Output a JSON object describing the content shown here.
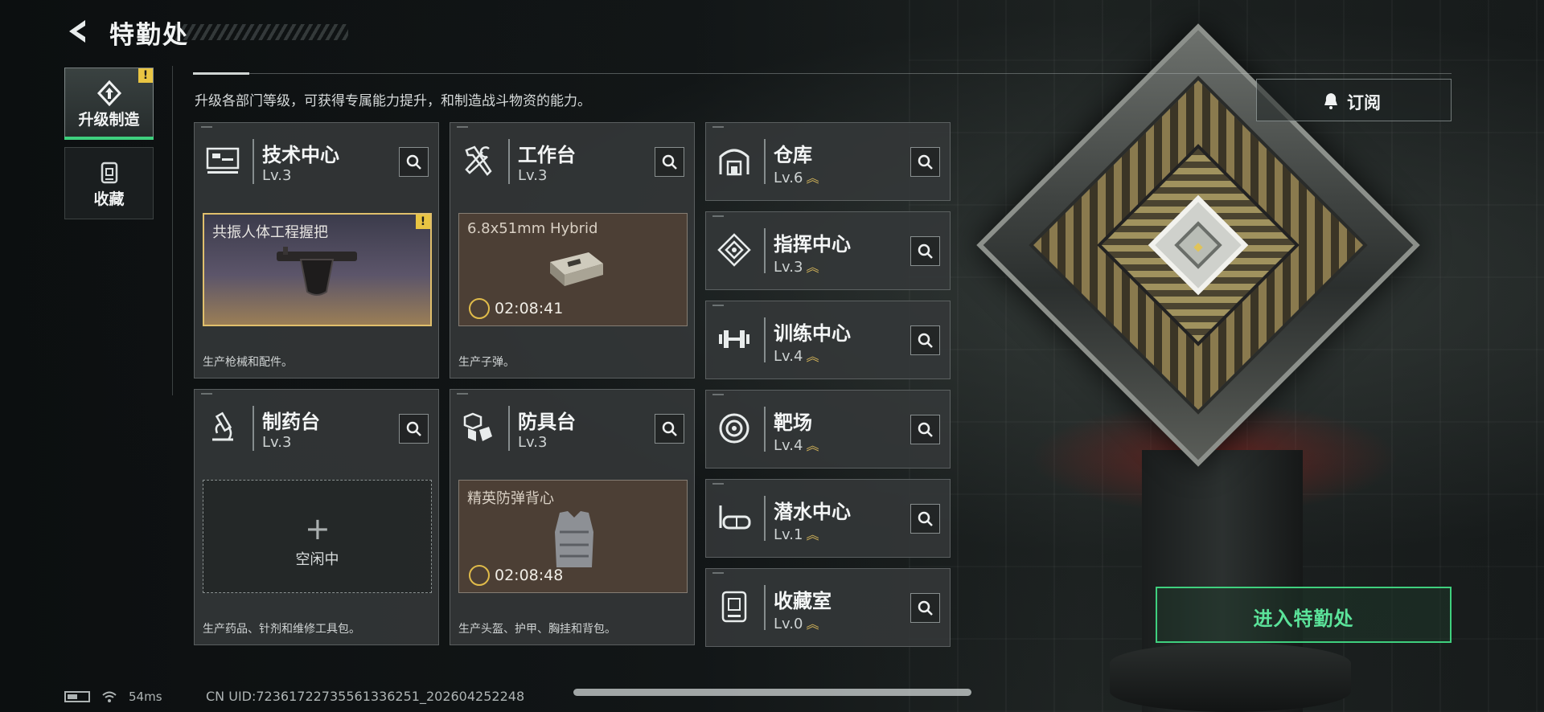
{
  "header": {
    "title": "特勤处"
  },
  "subtitle": "升级各部门等级，可获得专属能力提升，和制造战斗物资的能力。",
  "nav": [
    {
      "label": "升级制造",
      "alert": "!"
    },
    {
      "label": "收藏"
    }
  ],
  "subscribe_label": "订阅",
  "enter_label": "进入特勤处",
  "departments": {
    "tech": {
      "name": "技术中心",
      "level": "Lv.3",
      "slot_title": "共振人体工程握把",
      "slot_alert": "!",
      "desc": "生产枪械和配件。"
    },
    "workbench": {
      "name": "工作台",
      "level": "Lv.3",
      "slot_title": "6.8x51mm Hybrid",
      "timer": "02:08:41",
      "desc": "生产子弹。"
    },
    "pharmacy": {
      "name": "制药台",
      "level": "Lv.3",
      "plus": "+",
      "slot_title": "空闲中",
      "desc": "生产药品、针剂和维修工具包。"
    },
    "armor": {
      "name": "防具台",
      "level": "Lv.3",
      "slot_title": "精英防弹背心",
      "timer": "02:08:48",
      "desc": "生产头盔、护甲、胸挂和背包。"
    },
    "storage": {
      "name": "仓库",
      "level": "Lv.6"
    },
    "command": {
      "name": "指挥中心",
      "level": "Lv.3"
    },
    "training": {
      "name": "训练中心",
      "level": "Lv.4"
    },
    "range": {
      "name": "靶场",
      "level": "Lv.4"
    },
    "diving": {
      "name": "潜水中心",
      "level": "Lv.1"
    },
    "collection": {
      "name": "收藏室",
      "level": "Lv.0"
    }
  },
  "status": {
    "ping": "54ms",
    "uid": "CN UID:7236172273556133​6251_202604252248"
  },
  "colors": {
    "accent_green": "#3fd07e",
    "gold": "#e0bf6c",
    "alert_yellow": "#e9c543"
  }
}
